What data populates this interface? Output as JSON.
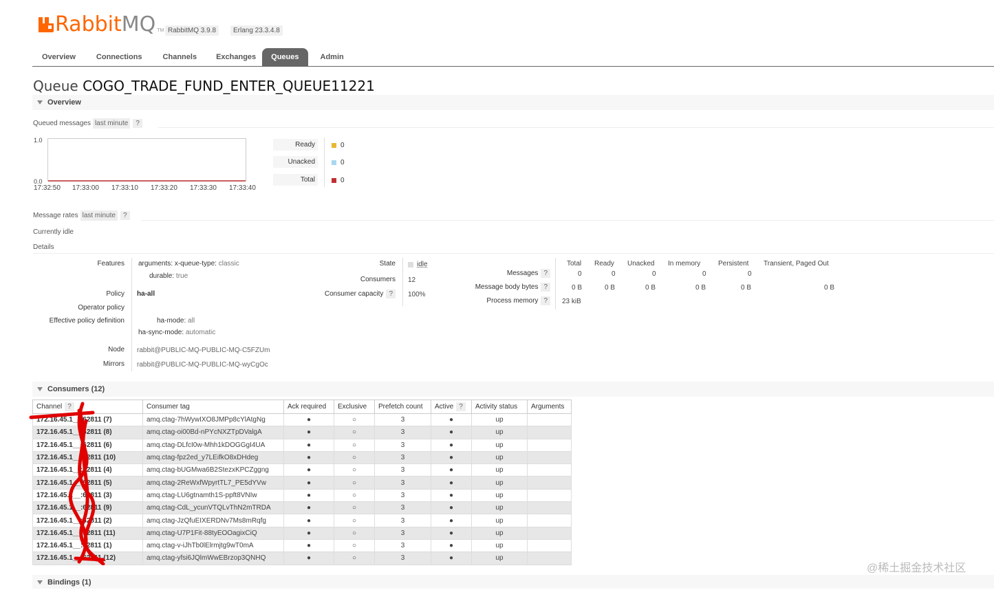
{
  "brand": {
    "rabbit": "Rabbit",
    "mq": "MQ",
    "tm": "TM"
  },
  "versions": [
    "RabbitMQ 3.9.8",
    "Erlang 23.3.4.8"
  ],
  "tabs": [
    "Overview",
    "Connections",
    "Channels",
    "Exchanges",
    "Queues",
    "Admin"
  ],
  "active_tab": "Queues",
  "title": {
    "prefix": "Queue",
    "name": "COGO_TRADE_FUND_ENTER_QUEUE11221"
  },
  "overview": {
    "heading": "Overview",
    "queued_label": "Queued messages",
    "range": "last minute",
    "help": "?",
    "chart": {
      "y_ticks": [
        "1.0",
        "0.0"
      ],
      "x_ticks": [
        "17:32:50",
        "17:33:00",
        "17:33:10",
        "17:33:20",
        "17:33:30",
        "17:33:40"
      ]
    },
    "legend": [
      {
        "label": "Ready",
        "value": "0",
        "color": "#e8b830"
      },
      {
        "label": "Unacked",
        "value": "0",
        "color": "#a8d8f0"
      },
      {
        "label": "Total",
        "value": "0",
        "color": "#c03030"
      }
    ],
    "rates_label": "Message rates",
    "idle": "Currently idle",
    "details": "Details"
  },
  "details": {
    "features_label": "Features",
    "arguments_key": "arguments:",
    "arguments_sub": "x-queue-type:",
    "arguments_val": "classic",
    "durable_key": "durable:",
    "durable_val": "true",
    "policy_label": "Policy",
    "policy_val": "ha-all",
    "operator_policy_label": "Operator policy",
    "effective_label": "Effective policy definition",
    "ha_mode_key": "ha-mode:",
    "ha_mode_val": "all",
    "ha_sync_key": "ha-sync-mode:",
    "ha_sync_val": "automatic",
    "node_label": "Node",
    "node_val": "rabbit@PUBLIC-MQ-PUBLIC-MQ-C5FZUm",
    "mirrors_label": "Mirrors",
    "mirrors_val": "rabbit@PUBLIC-MQ-PUBLIC-MQ-wyCgOc",
    "state_label": "State",
    "state_val": "idle",
    "consumers_label": "Consumers",
    "consumers_val": "12",
    "capacity_label": "Consumer capacity",
    "capacity_val": "100%"
  },
  "stats": {
    "columns": [
      "Total",
      "Ready",
      "Unacked",
      "In memory",
      "Persistent",
      "Transient, Paged Out"
    ],
    "rows": [
      {
        "label": "Messages",
        "values": [
          "0",
          "0",
          "0",
          "0",
          "0",
          ""
        ]
      },
      {
        "label": "Message body bytes",
        "values": [
          "0 B",
          "0 B",
          "0 B",
          "0 B",
          "0 B",
          "0 B"
        ]
      },
      {
        "label": "Process memory",
        "values": [
          "23 kiB",
          "",
          "",
          "",
          "",
          ""
        ]
      }
    ]
  },
  "consumers": {
    "heading": "Consumers (12)",
    "columns": [
      "Channel",
      "Consumer tag",
      "Ack required",
      "Exclusive",
      "Prefetch count",
      "Active",
      "Activity status",
      "Arguments"
    ],
    "rows": [
      {
        "channel": "172.16.45.1__:62811 (7)",
        "tag": "amq.ctag-7hWywIXO8JMPp8cYlAtgNg",
        "ack": "●",
        "excl": "○",
        "prefetch": "3",
        "active": "●",
        "status": "up"
      },
      {
        "channel": "172.16.45.1__:62811 (8)",
        "tag": "amq.ctag-oi00Bd-nPYcNXZTpDValgA",
        "ack": "●",
        "excl": "○",
        "prefetch": "3",
        "active": "●",
        "status": "up"
      },
      {
        "channel": "172.16.45.1__:62811 (6)",
        "tag": "amq.ctag-DLfcI0w-Mhh1kDOGGgI4UA",
        "ack": "●",
        "excl": "○",
        "prefetch": "3",
        "active": "●",
        "status": "up"
      },
      {
        "channel": "172.16.45.1__:62811 (10)",
        "tag": "amq.ctag-fpz2ed_y7LEifkO8xDHdeg",
        "ack": "●",
        "excl": "○",
        "prefetch": "3",
        "active": "●",
        "status": "up"
      },
      {
        "channel": "172.16.45.1__:62811 (4)",
        "tag": "amq.ctag-bUGMwa6B2StezxKPCZggng",
        "ack": "●",
        "excl": "○",
        "prefetch": "3",
        "active": "●",
        "status": "up"
      },
      {
        "channel": "172.16.45.1__:62811 (5)",
        "tag": "amq.ctag-2ReWxfWpyrtTL7_PE5dYVw",
        "ack": "●",
        "excl": "○",
        "prefetch": "3",
        "active": "●",
        "status": "up"
      },
      {
        "channel": "172.16.45.1__:62811 (3)",
        "tag": "amq.ctag-LU6gtnamth1S-ppft8VNIw",
        "ack": "●",
        "excl": "○",
        "prefetch": "3",
        "active": "●",
        "status": "up"
      },
      {
        "channel": "172.16.45.1__:62811 (9)",
        "tag": "amq.ctag-CdL_ycunVTQLvThN2mTRDA",
        "ack": "●",
        "excl": "○",
        "prefetch": "3",
        "active": "●",
        "status": "up"
      },
      {
        "channel": "172.16.45.1__:62811 (2)",
        "tag": "amq.ctag-JzQfuEIXERDNv7Ms8mRqfg",
        "ack": "●",
        "excl": "○",
        "prefetch": "3",
        "active": "●",
        "status": "up"
      },
      {
        "channel": "172.16.45.1__:62811 (11)",
        "tag": "amq.ctag-U7P1Fit-88tyEOOagixCiQ",
        "ack": "●",
        "excl": "○",
        "prefetch": "3",
        "active": "●",
        "status": "up"
      },
      {
        "channel": "172.16.45.1__:62811 (1)",
        "tag": "amq.ctag-v-iJhTb0lElrmjtg9wT0mA",
        "ack": "●",
        "excl": "○",
        "prefetch": "3",
        "active": "●",
        "status": "up"
      },
      {
        "channel": "172.16.45.1__:62811 (12)",
        "tag": "amq.ctag-yfsi6JQlmWwEBrzop3QNHQ",
        "ack": "●",
        "excl": "○",
        "prefetch": "3",
        "active": "●",
        "status": "up"
      }
    ]
  },
  "bindings": {
    "heading": "Bindings (1)"
  },
  "watermark": "@稀土掘金技术社区"
}
